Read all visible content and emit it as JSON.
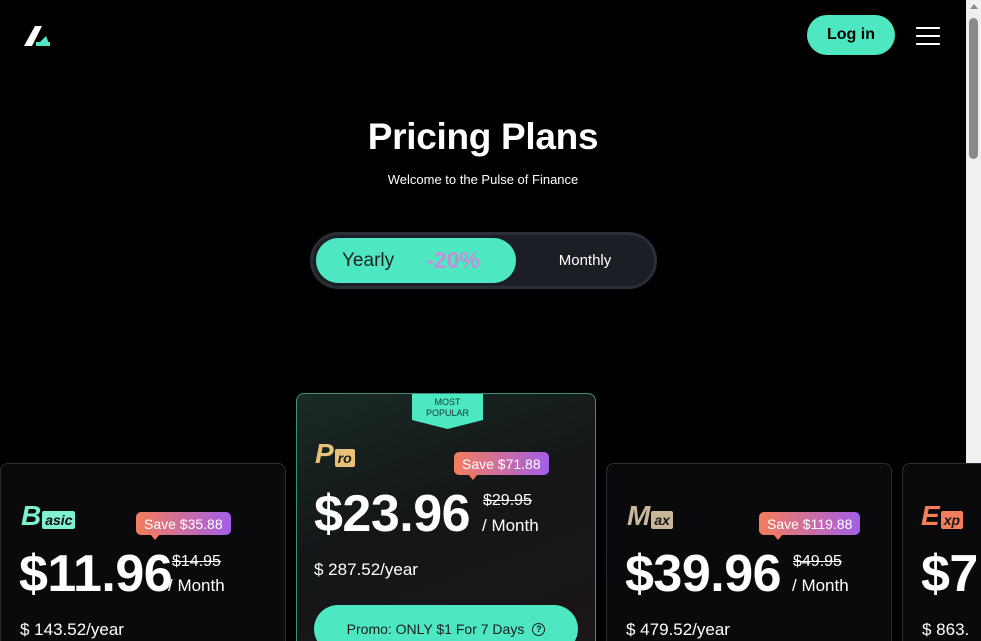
{
  "header": {
    "login_label": "Log in"
  },
  "hero": {
    "title": "Pricing Plans",
    "subtitle": "Welcome to the Pulse of Finance"
  },
  "billing_toggle": {
    "yearly_label": "Yearly",
    "yearly_discount": "-20%",
    "monthly_label": "Monthly",
    "selected": "Yearly"
  },
  "plans": [
    {
      "name_initial": "B",
      "name_rest": "asic",
      "save": "Save $35.88",
      "price": "$11.96",
      "old_price": "$14.95",
      "per": "/ Month",
      "yearly": "$ 143.52/year"
    },
    {
      "name_initial": "P",
      "name_rest": "ro",
      "badge": "MOST POPULAR",
      "save": "Save $71.88",
      "price": "$23.96",
      "old_price": "$29.95",
      "per": "/ Month",
      "yearly": "$ 287.52/year",
      "promo": "Promo: ONLY $1 For 7 Days"
    },
    {
      "name_initial": "M",
      "name_rest": "ax",
      "save": "Save $119.88",
      "price": "$39.96",
      "old_price": "$49.95",
      "per": "/ Month",
      "yearly": "$ 479.52/year"
    },
    {
      "name_initial": "E",
      "name_rest": "xp",
      "price": "$7",
      "yearly": "$ 863."
    }
  ],
  "colors": {
    "accent": "#4de8c2",
    "background": "#000000",
    "basic_name": "#7ff0d0",
    "pro_name": "#e8c178",
    "max_name": "#c9b79c",
    "expert_name": "#f47d5c"
  },
  "icons": {
    "logo": "brand-logo-icon",
    "menu": "hamburger-menu-icon",
    "help": "question-circle-icon"
  }
}
